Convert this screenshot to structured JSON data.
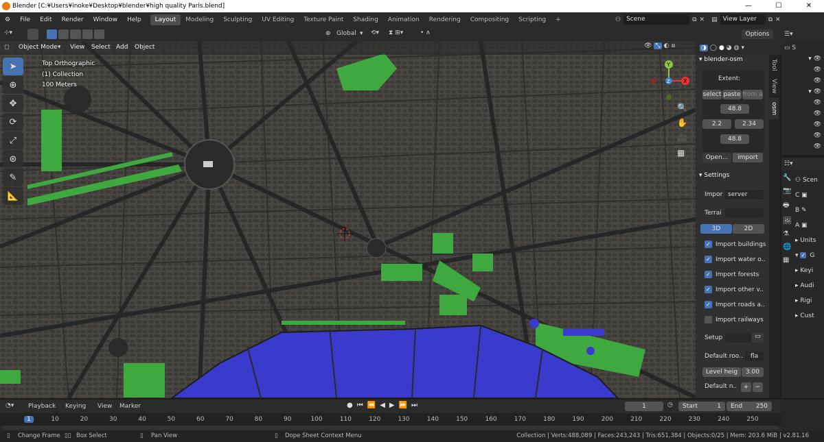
{
  "titlebar": {
    "title": "Blender [C:¥Users¥inoke¥Desktop¥blender¥high quality Paris.blend]",
    "minimize": "—",
    "maximize": "☐",
    "close": "✕"
  },
  "menu": [
    "File",
    "Edit",
    "Render",
    "Window",
    "Help"
  ],
  "workspaces": [
    "Layout",
    "Modeling",
    "Sculpting",
    "UV Editing",
    "Texture Paint",
    "Shading",
    "Animation",
    "Rendering",
    "Compositing",
    "Scripting",
    "+"
  ],
  "topright": {
    "scene": "Scene",
    "view_layer": "View Layer"
  },
  "header2": {
    "orientation": "Global",
    "options": "Options"
  },
  "viewport_header": {
    "mode": "Object Mode",
    "menus": [
      "View",
      "Select",
      "Add",
      "Object"
    ]
  },
  "viewport_info": {
    "view": "Top Orthographic",
    "collection": "(1) Collection",
    "scale": "100 Meters"
  },
  "npanel": {
    "panel_title": "blender-osm",
    "extent_label": "Extent:",
    "select": "select",
    "paste": "paste",
    "from_a": "from a",
    "north": "48.8",
    "west": "2.2",
    "east": "2.34",
    "south": "48.8",
    "open": "Open...",
    "import": "import",
    "settings": "Settings",
    "import_label": "Impor",
    "server": "server",
    "terrain_label": "Terrai",
    "mode_3d": "3D",
    "mode_2d": "2D",
    "checks": [
      {
        "label": "Import buildings",
        "on": true
      },
      {
        "label": "Import water o..",
        "on": true
      },
      {
        "label": "Import forests",
        "on": true
      },
      {
        "label": "Import other v..",
        "on": true
      },
      {
        "label": "Import roads a..",
        "on": true
      },
      {
        "label": "Import railways",
        "on": false
      }
    ],
    "setup": "Setup",
    "default_roof": "Default roo..",
    "roof_val": "fla",
    "level_height": "Level heig",
    "level_val": "3.00",
    "default_n": "Default n.."
  },
  "ntabs": [
    "Tool",
    "View",
    "osm"
  ],
  "outliner": {
    "s": "S"
  },
  "props": {
    "scene": "Scen",
    "c": "C",
    "b": "B",
    "a": "A",
    "units": "Units",
    "g": "G",
    "keyi": "Keyi",
    "audi": "Audi",
    "rigid": "Rigi",
    "cust": "Cust"
  },
  "timeline": {
    "menus": [
      "Playback",
      "Keying",
      "View",
      "Marker"
    ],
    "current": "1",
    "start_label": "Start",
    "start": "1",
    "end_label": "End",
    "end": "250",
    "ticks": [
      "1",
      "10",
      "20",
      "30",
      "40",
      "50",
      "60",
      "70",
      "80",
      "90",
      "100",
      "110",
      "120",
      "130",
      "140",
      "150",
      "160",
      "170",
      "180",
      "190",
      "200",
      "210",
      "220",
      "230",
      "240",
      "250"
    ]
  },
  "status": {
    "change_frame": "Change Frame",
    "box_select": "Box Select",
    "pan_view": "Pan View",
    "dope": "Dope Sheet Context Menu",
    "stats": "Collection | Verts:488,089 | Faces:243,243 | Tris:651,384 | Objects:0/25 | Mem: 203.6 MiB | v2.81.16"
  },
  "colors": {
    "accent": "#4772b3",
    "water": "#3a3acc",
    "park": "#3fa83f",
    "ground": "#4a4742",
    "road": "#2a2a2a",
    "building": "#3c3a37"
  }
}
